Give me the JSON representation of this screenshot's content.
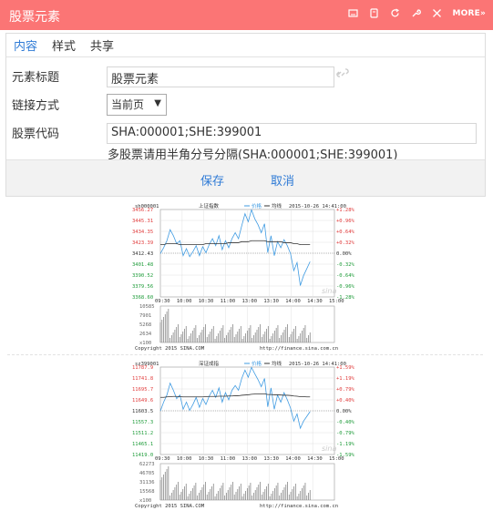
{
  "window": {
    "title": "股票元素",
    "more_label": "MORE»"
  },
  "tabs": [
    {
      "label": "内容"
    },
    {
      "label": "样式"
    },
    {
      "label": "共享"
    }
  ],
  "form": {
    "title_label": "元素标题",
    "title_value": "股票元素",
    "link_label": "链接方式",
    "link_value": "当前页",
    "code_label": "股票代码",
    "code_value": "SHA:000001;SHE:399001",
    "code_hint": "多股票请用半角分号分隔(SHA:000001;SHE:399001)"
  },
  "buttons": {
    "save": "保存",
    "cancel": "取消"
  },
  "colors": {
    "accent": "#fb7575",
    "link": "#2f7bd6",
    "up": "#e03b3b",
    "down": "#1d9b38",
    "price": "#3f9be2",
    "avg": "#333333"
  },
  "charts": [
    {
      "code": "sh000001",
      "name": "上证指数",
      "legend_price": "价格",
      "legend_avg": "均线",
      "datetime": "2015-10-26 14:41:00",
      "y_left": [
        "3456.27",
        "3445.31",
        "3434.35",
        "3423.39",
        "3412.43",
        "3401.48",
        "3390.52",
        "3379.56",
        "3368.60"
      ],
      "y_right": [
        "+1.28%",
        "+0.96%",
        "+0.64%",
        "+0.32%",
        "0.00%",
        "-0.32%",
        "-0.64%",
        "-0.96%",
        "-1.28%"
      ],
      "x_ticks": [
        "09:30",
        "10:00",
        "10:30",
        "11:00",
        "13:00",
        "13:30",
        "14:00",
        "14:30",
        "15:00"
      ],
      "vol_ticks": [
        "10585",
        "7901",
        "5268",
        "2634",
        "x100"
      ],
      "copyright": "Copyright 2015 SINA.COM",
      "source": "http://finance.sina.com.cn",
      "watermark": "sina",
      "prices": [
        3412,
        3418,
        3425,
        3436,
        3430,
        3422,
        3425,
        3410,
        3417,
        3409,
        3414,
        3420,
        3410,
        3419,
        3413,
        3421,
        3427,
        3420,
        3430,
        3416,
        3425,
        3418,
        3427,
        3433,
        3427,
        3440,
        3452,
        3444,
        3456,
        3447,
        3441,
        3433,
        3442,
        3413,
        3430,
        3410,
        3424,
        3418,
        3426,
        3420,
        3412,
        3395,
        3403,
        3380,
        3390,
        3397,
        3404
      ],
      "avg": [
        3421,
        3421,
        3422,
        3422,
        3422,
        3422,
        3421,
        3421,
        3421,
        3421,
        3421,
        3421,
        3421,
        3421,
        3422,
        3422,
        3422,
        3422,
        3422,
        3422,
        3422,
        3423,
        3423,
        3423,
        3423,
        3424,
        3424,
        3424,
        3425,
        3425,
        3425,
        3425,
        3425,
        3424,
        3424,
        3424,
        3424,
        3424,
        3423,
        3423,
        3423,
        3422,
        3422,
        3421,
        3421,
        3421,
        3421
      ]
    },
    {
      "code": "sz399001",
      "name": "深证成指",
      "legend_price": "价格",
      "legend_avg": "均线",
      "datetime": "2015-10-26 14:41:00",
      "y_left": [
        "11787.9",
        "11741.8",
        "11695.7",
        "11649.6",
        "11603.5",
        "11557.3",
        "11511.2",
        "11465.1",
        "11419.0"
      ],
      "y_right": [
        "+1.59%",
        "+1.19%",
        "+0.79%",
        "+0.40%",
        "0.00%",
        "-0.40%",
        "-0.79%",
        "-1.19%",
        "-1.59%"
      ],
      "x_ticks": [
        "09:30",
        "10:00",
        "10:30",
        "11:00",
        "13:00",
        "13:30",
        "14:00",
        "14:30",
        "15:00"
      ],
      "vol_ticks": [
        "62273",
        "46705",
        "31136",
        "15568",
        "x100"
      ],
      "copyright": "Copyright 2015 SINA.COM",
      "source": "http://finance.sina.com.cn",
      "watermark": "sina",
      "prices": [
        11603,
        11640,
        11670,
        11720,
        11690,
        11655,
        11670,
        11610,
        11640,
        11605,
        11630,
        11660,
        11618,
        11655,
        11630,
        11665,
        11690,
        11660,
        11700,
        11640,
        11680,
        11650,
        11690,
        11710,
        11690,
        11740,
        11775,
        11745,
        11787,
        11760,
        11735,
        11705,
        11740,
        11620,
        11700,
        11610,
        11670,
        11640,
        11680,
        11650,
        11615,
        11560,
        11590,
        11530,
        11560,
        11580,
        11600
      ],
      "avg": [
        11660,
        11660,
        11662,
        11663,
        11664,
        11664,
        11663,
        11662,
        11662,
        11662,
        11662,
        11662,
        11662,
        11662,
        11663,
        11664,
        11664,
        11664,
        11665,
        11665,
        11665,
        11666,
        11666,
        11667,
        11667,
        11669,
        11670,
        11671,
        11673,
        11674,
        11674,
        11675,
        11675,
        11672,
        11672,
        11671,
        11671,
        11670,
        11669,
        11669,
        11668,
        11666,
        11665,
        11663,
        11663,
        11662,
        11662
      ]
    }
  ]
}
